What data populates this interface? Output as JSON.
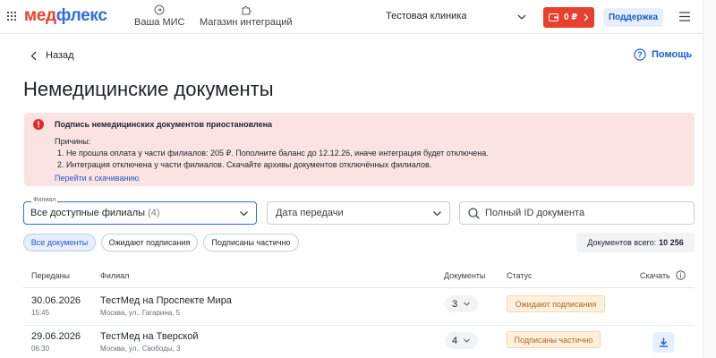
{
  "header": {
    "logo_part1": "мед",
    "logo_part2": "флекс",
    "nav": [
      {
        "label": "Ваша МИС"
      },
      {
        "label": "Магазин интеграций"
      }
    ],
    "clinic": "Тестовая клиника",
    "balance": "0 ₽",
    "support": "Поддержка"
  },
  "page": {
    "back": "Назад",
    "help": "Помощь",
    "title": "Немедицинские документы"
  },
  "alert": {
    "title": "Подпись немедицинских документов приостановлена",
    "reasons_label": "Причины:",
    "items": [
      "1. Не прошла оплата у части филиалов: 205 ₽. Пополните баланс до 12.12.26, иначе интеграция будет отключена.",
      "2. Интеграция отключена у части филиалов. Скачайте архивы документов отключённых филиалов."
    ],
    "link": "Перейти к скачиванию"
  },
  "filters": {
    "branch_label": "Филиал",
    "branch_value": "Все доступные филиалы",
    "branch_count": "(4)",
    "date_placeholder": "Дата передачи",
    "search_placeholder": "Полный ID документа"
  },
  "chips": [
    {
      "label": "Все документы",
      "active": true
    },
    {
      "label": "Ожидают подписания",
      "active": false
    },
    {
      "label": "Подписаны частично",
      "active": false
    }
  ],
  "total": {
    "label": "Документов всего:",
    "value": "10 256"
  },
  "table": {
    "columns": [
      "Переданы",
      "Филиал",
      "Документы",
      "Статус",
      "Скачать"
    ],
    "rows": [
      {
        "date": "30.06.2026",
        "time": "15:45",
        "branch": "ТестМед на Проспекте Мира",
        "address": "Москва, ул.. Гагарина, 5",
        "docs": "3",
        "status": "Ожидают подписания"
      },
      {
        "date": "29.06.2026",
        "time": "06:30",
        "branch": "ТестМед на Тверской",
        "address": "Москва, ул.. Свободы, 3",
        "docs": "4",
        "status": "Подписаны частично"
      }
    ]
  },
  "colors": {
    "brand_red": "#e8402f",
    "brand_blue": "#2f6be5",
    "alert_bg": "#fbe3e2",
    "status_warning": "#b5651d"
  },
  "icons": [
    "apps-grid-icon",
    "arrow-in-circle-icon",
    "puzzle-icon",
    "chevron-down-icon",
    "wallet-icon",
    "chevron-right-icon",
    "hamburger-menu-icon",
    "chevron-left-icon",
    "question-circle-icon",
    "error-circle-icon",
    "search-icon",
    "info-icon",
    "download-icon"
  ]
}
